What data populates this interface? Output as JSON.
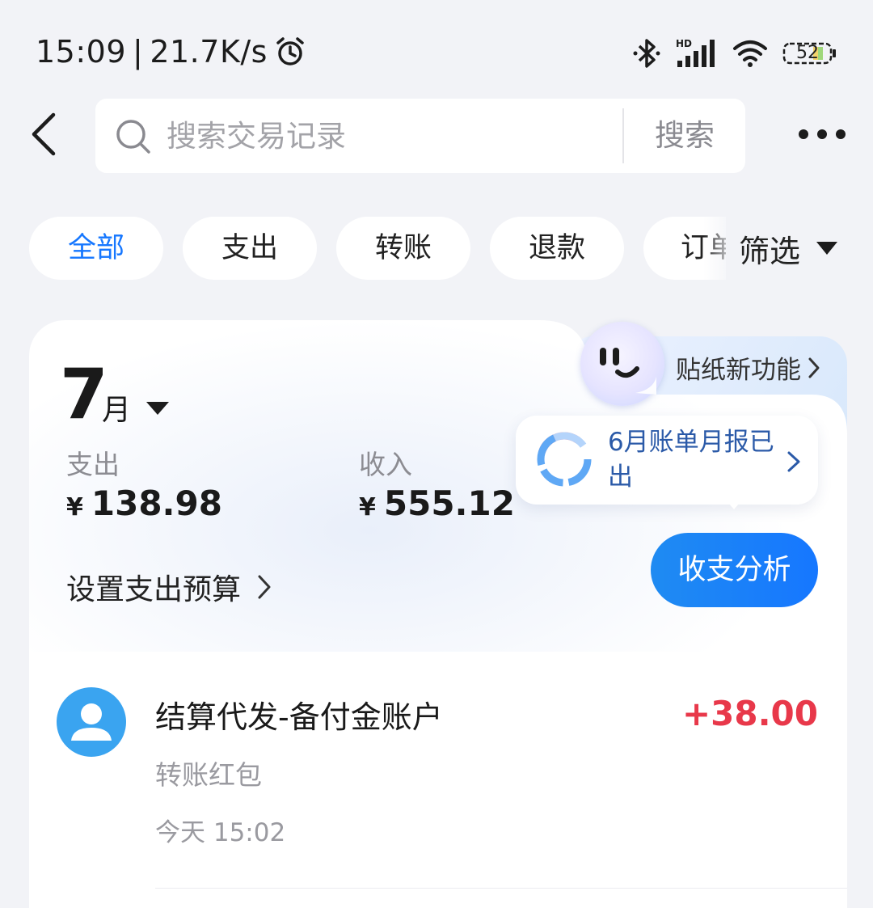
{
  "status_bar": {
    "time": "15:09",
    "separator": "|",
    "net_speed": "21.7K/s",
    "battery": "52"
  },
  "search": {
    "placeholder": "搜索交易记录",
    "button_label": "搜索"
  },
  "filters": {
    "chips": [
      {
        "label": "全部",
        "active": true
      },
      {
        "label": "支出",
        "active": false
      },
      {
        "label": "转账",
        "active": false
      },
      {
        "label": "退款",
        "active": false
      },
      {
        "label": "订单",
        "active": false
      }
    ],
    "filter_label": "筛选"
  },
  "summary": {
    "sticker_label": "贴纸新功能",
    "month_number": "7",
    "month_unit": "月",
    "expense_label": "支出",
    "expense_currency": "¥",
    "expense_value": "138.98",
    "income_label": "收入",
    "income_currency": "¥",
    "income_value": "555.12",
    "budget_label": "设置支出预算",
    "report_text": "6月账单月报已出",
    "analysis_button": "收支分析"
  },
  "transactions": [
    {
      "title": "结算代发-备付金账户",
      "subtitle": "转账红包",
      "time": "今天 15:02",
      "amount": "+38.00"
    }
  ],
  "colors": {
    "accent": "#1677ff",
    "income_amount": "#e8384a",
    "avatar": "#3aa4f0",
    "background": "#f2f3f7"
  }
}
